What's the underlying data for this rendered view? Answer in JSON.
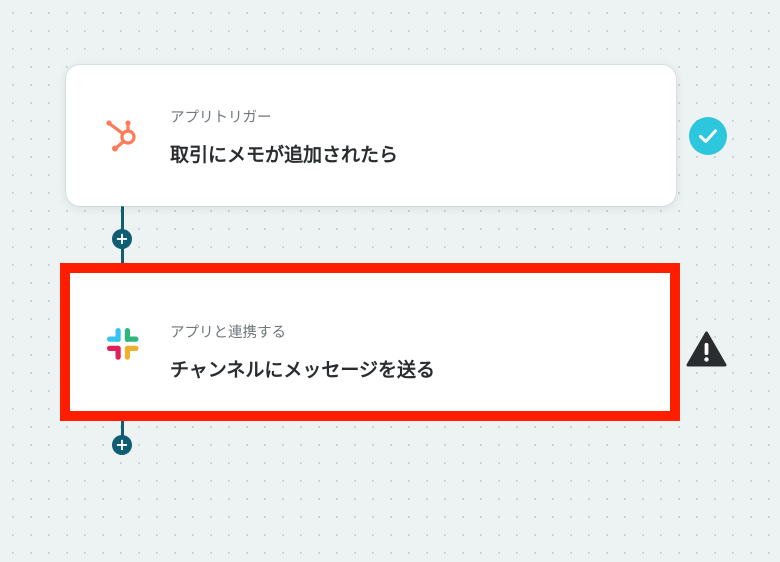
{
  "flow": {
    "steps": [
      {
        "type_label": "アプリトリガー",
        "title": "取引にメモが追加されたら",
        "app_icon": "hubspot-icon",
        "status": "success",
        "status_icon": "check-circle-icon"
      },
      {
        "type_label": "アプリと連携する",
        "title": "チャンネルにメッセージを送る",
        "app_icon": "slack-icon",
        "status": "warning",
        "status_icon": "warning-triangle-icon"
      }
    ],
    "add_step_label": "+"
  },
  "colors": {
    "background": "#edf2f2",
    "connector": "#0f5d73",
    "highlight_border": "#ff1f00",
    "success": "#2cc7dc",
    "warning": "#2a2d2f",
    "hubspot": "#ff7a59"
  }
}
